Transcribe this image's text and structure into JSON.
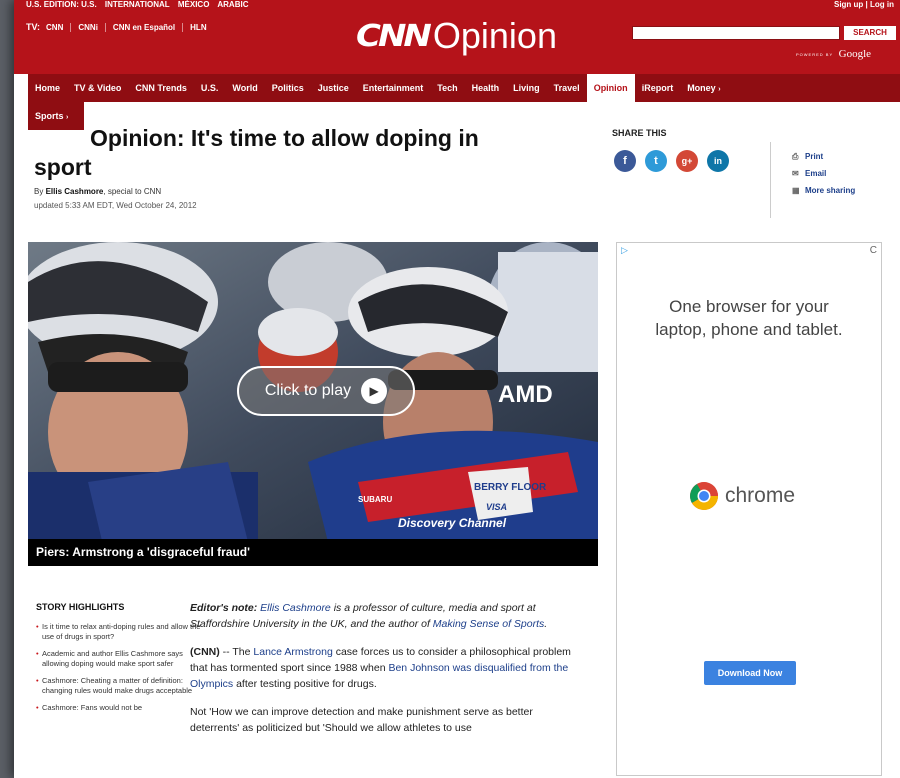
{
  "header": {
    "edition": [
      "U.S. EDITION: U.S.",
      "INTERNATIONAL",
      "MÉXICO",
      "ARABIC"
    ],
    "signup": "Sign up | Log in",
    "tv_label": "TV:",
    "tv_items": [
      "CNN",
      "CNNi",
      "CNN en Español",
      "HLN"
    ],
    "logo_cnn": "CNN",
    "logo_section": "Opinion",
    "search_placeholder": "",
    "search_button": "SEARCH",
    "powered_small": "POWERED BY",
    "powered_brand": "Google"
  },
  "nav": {
    "items": [
      "Home",
      "TV & Video",
      "CNN Trends",
      "U.S.",
      "World",
      "Politics",
      "Justice",
      "Entertainment",
      "Tech",
      "Health",
      "Living",
      "Travel",
      "Opinion",
      "iReport",
      "Money"
    ],
    "active": "Opinion",
    "money_arrow": "›",
    "sub_item": "Sports",
    "sub_arrow": "›"
  },
  "article": {
    "title_line1": "Opinion: It's time to allow doping in",
    "title_line2": "sport",
    "byline_prefix": "By",
    "author": "Ellis Cashmore",
    "byline_suffix": ", special to CNN",
    "updated": "updated 5:33 AM EDT, Wed October 24, 2012"
  },
  "share": {
    "label": "SHARE THIS",
    "icons": [
      {
        "name": "facebook-icon",
        "glyph": "f"
      },
      {
        "name": "twitter-icon",
        "glyph": "t"
      },
      {
        "name": "google-plus-icon",
        "glyph": "g+"
      },
      {
        "name": "linkedin-icon",
        "glyph": "in"
      }
    ],
    "links": [
      {
        "icon": "print-icon",
        "glyph": "⎙",
        "label": "Print"
      },
      {
        "icon": "email-icon",
        "glyph": "✉",
        "label": "Email"
      },
      {
        "icon": "more-sharing-icon",
        "glyph": "▦",
        "label": "More sharing"
      }
    ]
  },
  "video": {
    "play_label": "Click to play",
    "play_glyph": "▶",
    "caption": "Piers: Armstrong a 'disgraceful fraud'",
    "jersey_text": "AMD",
    "jersey_sponsor": "BERRY FLOOR",
    "jersey_brand": "VISA",
    "jersey_channel": "Discovery Channel",
    "bike_sponsor": "SUBARU"
  },
  "ad": {
    "choice_glyph": "▷",
    "reload_glyph": "C",
    "text_line1": "One browser for your",
    "text_line2": "laptop, phone and tablet.",
    "brand": "chrome",
    "button": "Download Now"
  },
  "story": {
    "highlights_title": "STORY HIGHLIGHTS",
    "highlights": [
      "Is it time to relax anti-doping rules and allow the use of drugs in sport?",
      "Academic and author Ellis Cashmore says allowing doping would make sport safer",
      "Cashmore: Cheating a matter of definition: changing rules would make drugs acceptable",
      "Cashmore: Fans would not be"
    ],
    "editor_note_label": "Editor's note:",
    "editor_note_link": "Ellis Cashmore",
    "editor_note_text": " is a professor of culture, media and sport at Staffordshire University in the UK, and the author of ",
    "editor_note_book": "Making Sense of Sports",
    "editor_note_end": ".",
    "p1_lead": "(CNN)",
    "p1_a": " -- The ",
    "p1_link1": "Lance Armstrong",
    "p1_b": " case forces us to consider a philosophical problem that has tormented sport since 1988 when ",
    "p1_link2": "Ben Johnson was disqualified from the Olympics",
    "p1_c": " after testing positive for drugs.",
    "p2": "Not 'How we can improve detection and make punishment serve as better deterrents' as politicized but 'Should we allow athletes to use"
  }
}
